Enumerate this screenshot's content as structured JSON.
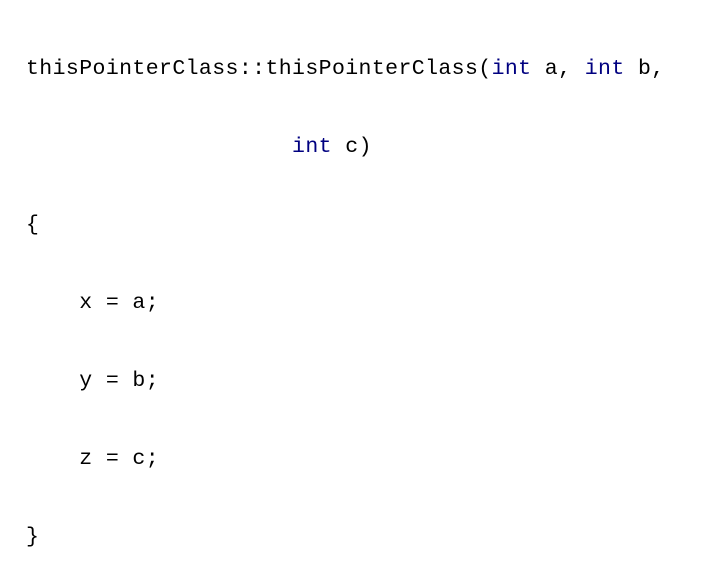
{
  "code": {
    "line1": {
      "prefix": "thisPointerClass::thisPointerClass(",
      "kw1": "int",
      "mid1": " a, ",
      "kw2": "int",
      "suffix": " b,"
    },
    "line2": {
      "indent": "                    ",
      "kw": "int",
      "suffix": " c)"
    },
    "open_brace": "{",
    "body": [
      "    x = a;",
      "    y = b;",
      "    z = c;"
    ],
    "close_brace": "}"
  },
  "colors": {
    "keyword": "#000080",
    "text": "#000000"
  }
}
